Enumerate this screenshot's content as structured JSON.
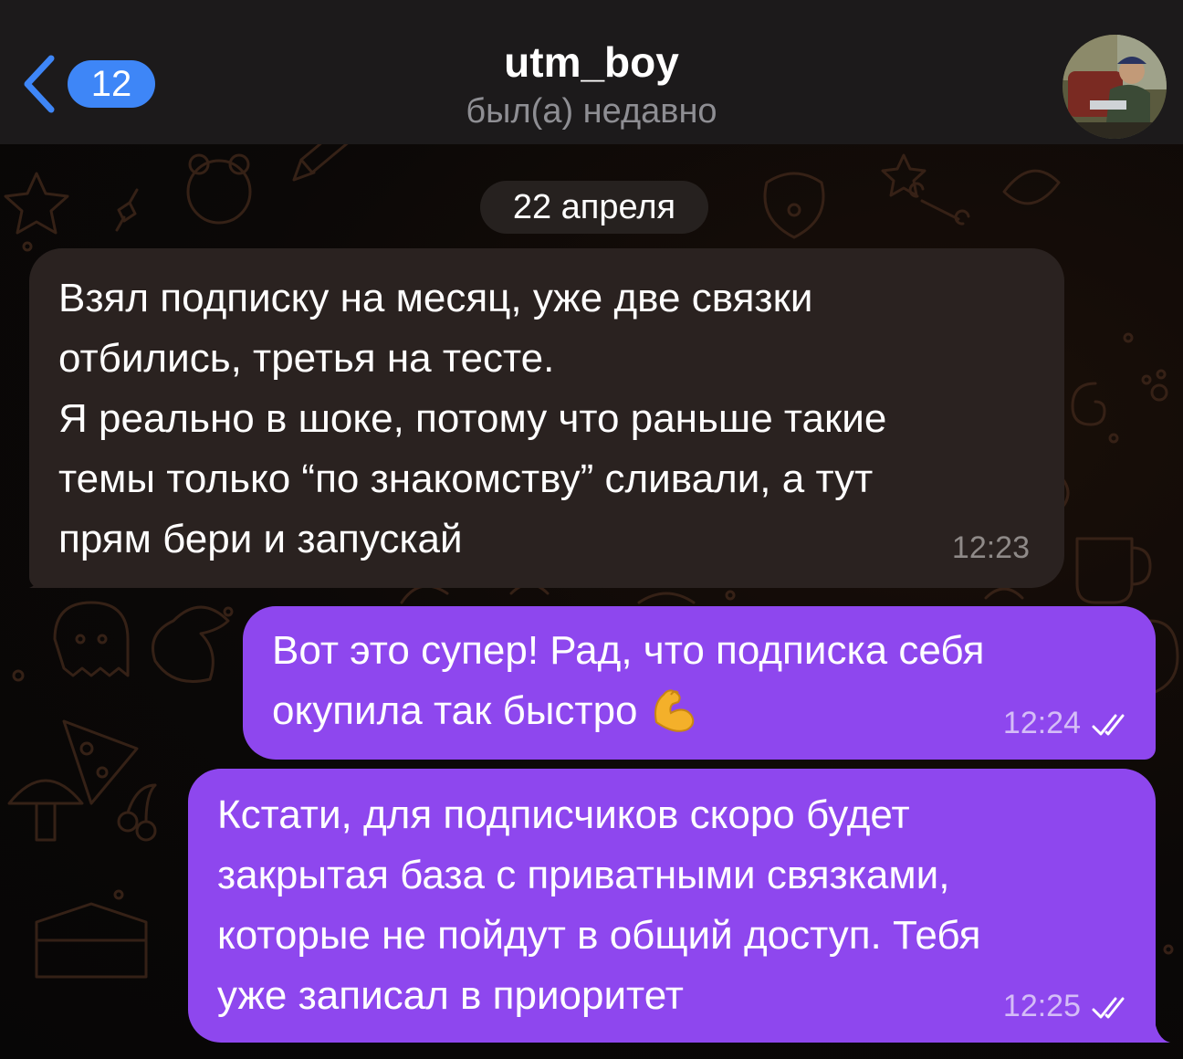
{
  "header": {
    "unread_count": "12",
    "title": "utm_boy",
    "status": "был(а) недавно"
  },
  "date_divider": "22 апреля",
  "messages": [
    {
      "direction": "incoming",
      "text": "Взял подписку на месяц, уже две связки\nотбились, третья на тесте.\nЯ реально в шоке, потому что раньше такие\nтемы только “по знакомству” сливали, а тут\nпрям бери и запускай",
      "time": "12:23"
    },
    {
      "direction": "outgoing",
      "text": "Вот это супер! Рад, что подписка себя\nокупила так быстро",
      "emoji": "flexed-biceps-icon",
      "time": "12:24",
      "status": "read"
    },
    {
      "direction": "outgoing",
      "text": "Кстати, для подписчиков скоро будет\nзакрытая база с приватными связками,\nкоторые не пойдут в общий доступ. Тебя\nуже записал в приоритет",
      "time": "12:25",
      "status": "read"
    }
  ],
  "colors": {
    "header_bg": "#1c1a1b",
    "badge_blue": "#3e86f7",
    "incoming_bubble": "#2a2220",
    "outgoing_bubble": "#8e47ee",
    "wallpaper_doodle": "#3a2418"
  }
}
